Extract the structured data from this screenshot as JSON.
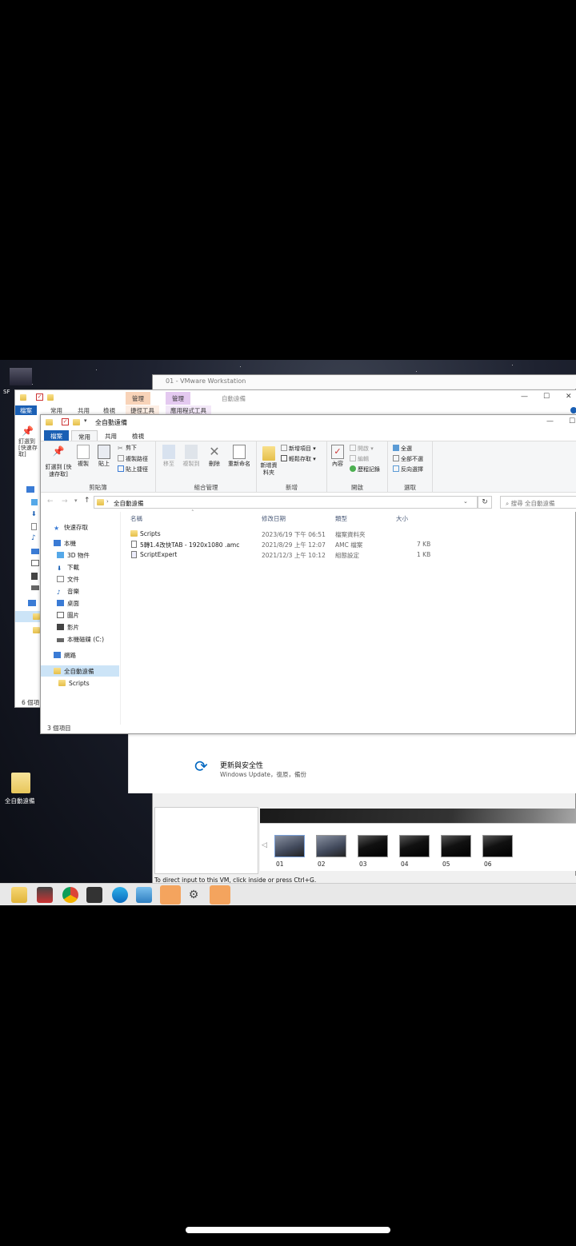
{
  "vmware": {
    "title": "01 - VMware Workstation",
    "status_text": "To direct input to this VM, click inside or press Ctrl+G.",
    "thumbnails": [
      "01",
      "02",
      "03",
      "04",
      "05",
      "06"
    ]
  },
  "settings_panel": {
    "title": "更新與安全性",
    "subtitle": "Windows Update，復原，備份"
  },
  "explorer_back": {
    "context_tab_1": "管理",
    "context_tab_2": "管理",
    "title": "自動遠備",
    "tabs": [
      "檔案",
      "常用",
      "共用",
      "檢視",
      "捷徑工具",
      "應用程式工具"
    ],
    "status": "6 個項目",
    "pin_label": "釘選到 [快速存取]",
    "sf_label": "SF"
  },
  "explorer_front": {
    "title": "全自動遠備",
    "tabs": [
      "檔案",
      "常用",
      "共用",
      "檢視"
    ],
    "ribbon": {
      "clipboard": {
        "label": "剪貼簿",
        "pin": "釘選到 [快速存取]",
        "copy": "複製",
        "paste": "貼上",
        "cut": "剪下",
        "copy_path": "複製路徑",
        "paste_shortcut": "貼上捷徑"
      },
      "organize": {
        "label": "組合管理",
        "move_to": "移至",
        "copy_to": "複製到",
        "delete": "刪除",
        "rename": "重新命名"
      },
      "new": {
        "label": "新增",
        "new_folder": "新增資料夾",
        "new_item": "新增項目",
        "easy_access": "輕鬆存取"
      },
      "open": {
        "label": "開啟",
        "properties": "內容",
        "open": "開啟",
        "edit": "編輯",
        "history": "歷程記錄"
      },
      "select": {
        "label": "選取",
        "select_all": "全選",
        "select_none": "全部不選",
        "invert": "反向選擇"
      }
    },
    "address": "全自動遠備",
    "search_placeholder": "搜尋 全自動遠備",
    "columns": [
      "名稱",
      "修改日期",
      "類型",
      "大小"
    ],
    "files": [
      {
        "name": "Scripts",
        "date": "2023/6/19 下午 06:51",
        "type": "檔案資料夾",
        "size": ""
      },
      {
        "name": "5轉1.4改快TAB - 1920x1080 .amc",
        "date": "2021/8/29 上午 12:07",
        "type": "AMC 檔案",
        "size": "7 KB"
      },
      {
        "name": "ScriptExpert",
        "date": "2021/12/3 上午 10:12",
        "type": "組態設定",
        "size": "1 KB"
      }
    ],
    "nav": {
      "quick_access": "快速存取",
      "this_pc": "本機",
      "objects_3d": "3D 物件",
      "downloads": "下載",
      "documents": "文件",
      "music": "音樂",
      "desktop": "桌面",
      "pictures": "圖片",
      "videos": "影片",
      "local_disk": "本機磁碟 (C:)",
      "network": "網路",
      "current_folder": "全自動遠備",
      "scripts": "Scripts"
    },
    "status": "3 個項目"
  },
  "desktop": {
    "folder_label": "全自動遠備"
  },
  "colors": {
    "file_tab": "#1a5fb4",
    "context_tab_1": "#f8d3b8",
    "context_tab_2": "#e4c9f0",
    "selected": "#cce4f7",
    "update_icon": "#0067c0"
  }
}
